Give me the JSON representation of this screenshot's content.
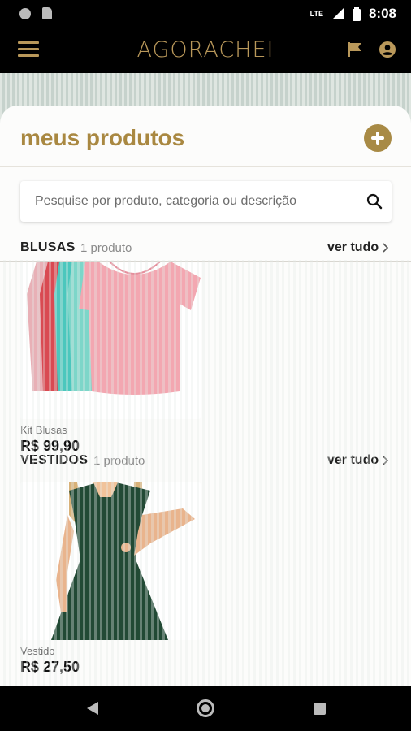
{
  "status_bar": {
    "time": "8:08",
    "network": "LTE"
  },
  "app": {
    "logo_text": "AGORACHEI"
  },
  "page": {
    "title": "meus produtos"
  },
  "search": {
    "placeholder": "Pesquise por produto, categoria ou descrição"
  },
  "sections": [
    {
      "name": "BLUSAS",
      "count": "1 produto",
      "see_all": "ver tudo",
      "products": [
        {
          "name": "Kit Blusas",
          "price": "R$ 99,90"
        }
      ]
    },
    {
      "name": "VESTIDOS",
      "count": "1 produto",
      "see_all": "ver tudo",
      "products": [
        {
          "name": "Vestido",
          "price": "R$ 27,50"
        }
      ]
    }
  ],
  "colors": {
    "accent": "#a98841",
    "logo": "#b9985a",
    "background": "#fcfcfb"
  },
  "icons": {
    "menu": "hamburger-menu-icon",
    "flag": "flag-icon",
    "user": "user-circle-icon",
    "add": "plus-circle-icon",
    "search": "search-icon",
    "chevron": "chevron-right-icon"
  }
}
